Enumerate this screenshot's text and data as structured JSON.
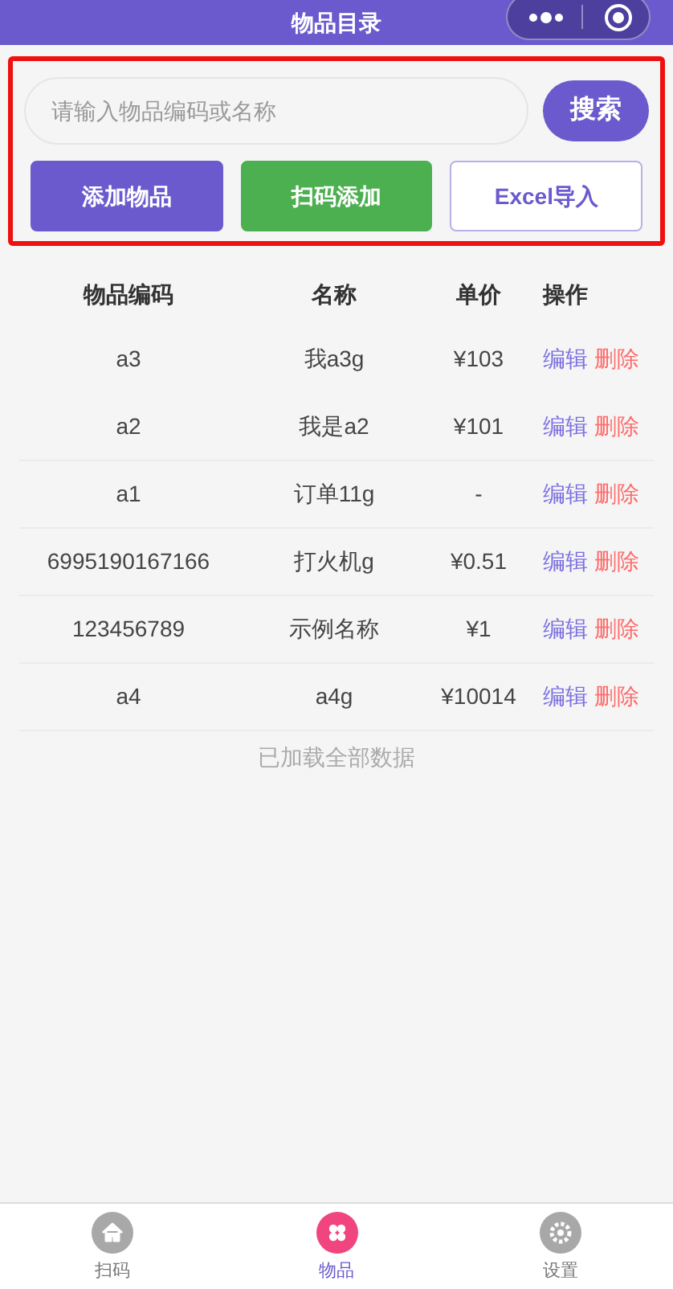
{
  "window": {
    "title": "物品目录"
  },
  "toolbar": {
    "highlighted": true,
    "search": {
      "placeholder": "请输入物品编码或名称",
      "button": "搜索"
    },
    "buttons": [
      {
        "label": "添加物品",
        "kind": "primary"
      },
      {
        "label": "扫码添加",
        "kind": "success"
      },
      {
        "label": "Excel导入",
        "kind": "outline"
      }
    ]
  },
  "table": {
    "columns": [
      "物品编码",
      "名称",
      "单价",
      "操作"
    ],
    "rows": [
      {
        "code": "a3",
        "name": "我a3g",
        "price": "¥103",
        "edit": "编辑",
        "delete": "删除"
      },
      {
        "code": "a2",
        "name": "我是a2",
        "price": "¥101",
        "edit": "编辑",
        "delete": "删除"
      },
      {
        "code": "a1",
        "name": "订单11g",
        "price": "-",
        "edit": "编辑",
        "delete": "删除"
      },
      {
        "code": "6995190167166",
        "name": "打火机g",
        "price": "¥0.51",
        "edit": "编辑",
        "delete": "删除"
      },
      {
        "code": "123456789",
        "name": "示例名称",
        "price": "¥1",
        "edit": "编辑",
        "delete": "删除"
      },
      {
        "code": "a4",
        "name": "a4g",
        "price": "¥10014",
        "edit": "编辑",
        "delete": "删除"
      }
    ]
  },
  "footer_note": "已加载全部数据",
  "tab_bar": [
    {
      "label": "扫码",
      "kind": "home",
      "selected": false
    },
    {
      "label": "物品",
      "kind": "grid",
      "selected": true
    },
    {
      "label": "设置",
      "kind": "gear",
      "selected": false
    }
  ]
}
